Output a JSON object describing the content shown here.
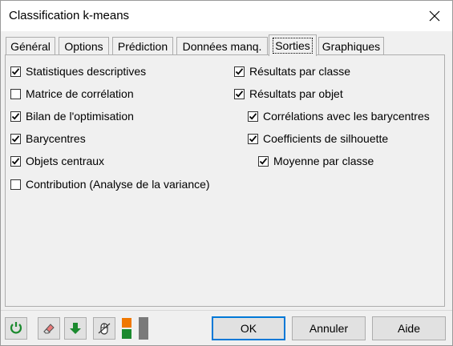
{
  "window": {
    "title": "Classification k-means"
  },
  "tabs": [
    {
      "label": "Général",
      "active": false
    },
    {
      "label": "Options",
      "active": false
    },
    {
      "label": "Prédiction",
      "active": false
    },
    {
      "label": "Données manq.",
      "active": false
    },
    {
      "label": "Sorties",
      "active": true
    },
    {
      "label": "Graphiques",
      "active": false
    }
  ],
  "left_options": [
    {
      "label": "Statistiques descriptives",
      "checked": true
    },
    {
      "label": "Matrice de corrélation",
      "checked": false
    },
    {
      "label": "Bilan de l'optimisation",
      "checked": true
    },
    {
      "label": "Barycentres",
      "checked": true
    },
    {
      "label": "Objets centraux",
      "checked": true
    },
    {
      "label": "Contribution (Analyse de la variance)",
      "checked": false
    }
  ],
  "right_options": [
    {
      "label": "Résultats par classe",
      "checked": true
    },
    {
      "label": "Résultats par objet",
      "checked": true
    },
    {
      "label": "Corrélations avec les barycentres",
      "checked": true
    },
    {
      "label": "Coefficients de silhouette",
      "checked": true
    },
    {
      "label": "Moyenne par classe",
      "checked": true
    }
  ],
  "toolbar_icons": [
    "reset-icon",
    "eraser-icon",
    "down-arrow-icon",
    "mouse-icon",
    "layout-toggle-icon"
  ],
  "buttons": {
    "ok": "OK",
    "cancel": "Annuler",
    "help": "Aide"
  },
  "colors": {
    "accent": "#0078d7",
    "green": "#1b8a2e",
    "orange": "#f07800"
  }
}
